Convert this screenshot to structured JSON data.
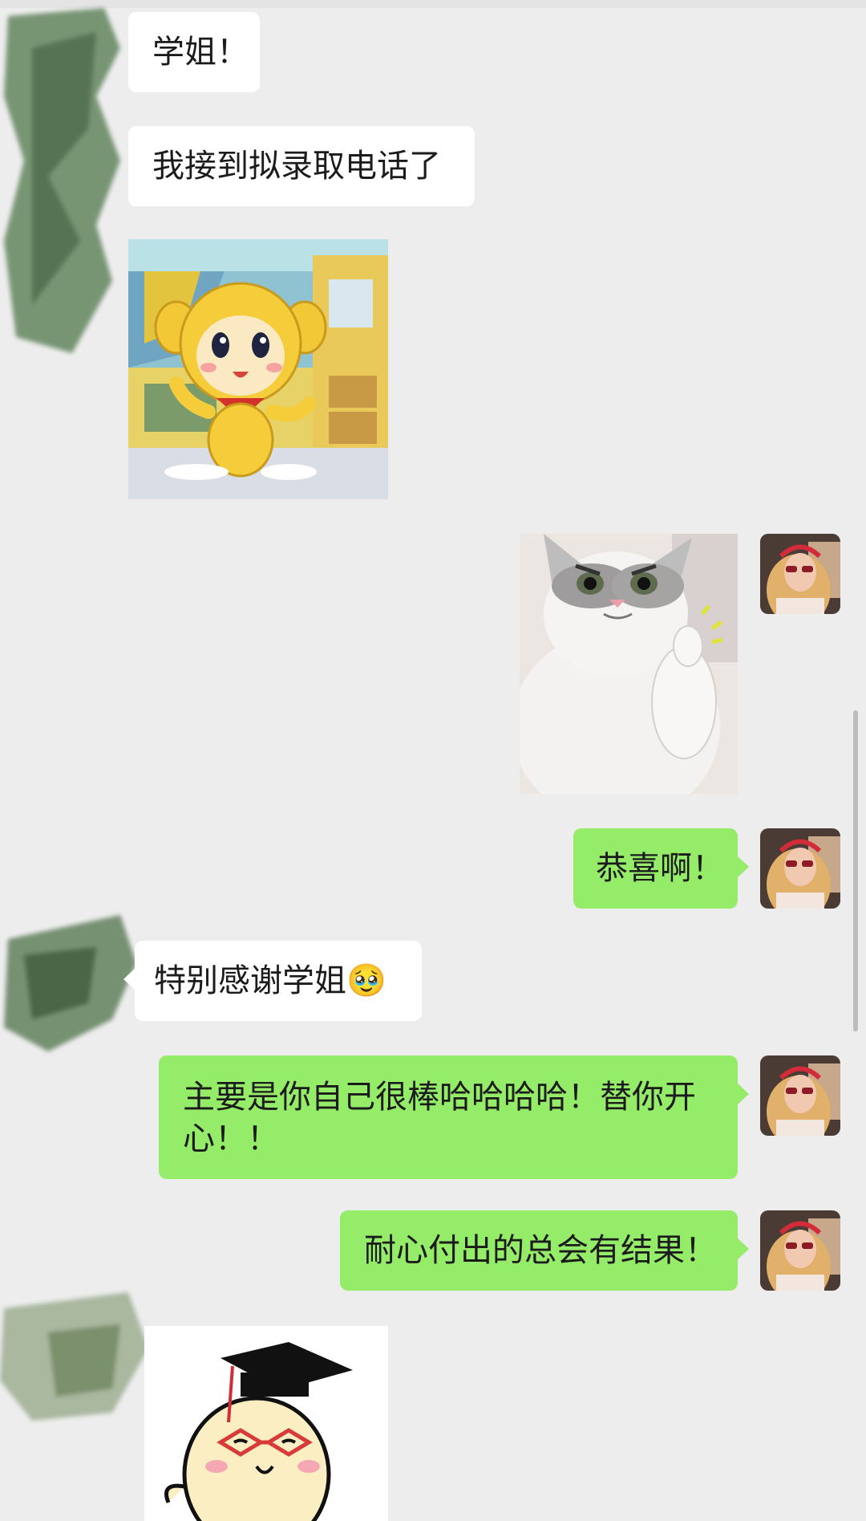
{
  "messages": [
    {
      "id": "m1",
      "side": "in",
      "type": "text",
      "text": "学姐！"
    },
    {
      "id": "m2",
      "side": "in",
      "type": "text",
      "text": "我接到拟录取电话了"
    },
    {
      "id": "m3",
      "side": "in",
      "type": "sticker",
      "icon": "yellow-monkey-sticker"
    },
    {
      "id": "m4",
      "side": "out",
      "type": "sticker",
      "icon": "thumbs-up-cat-sticker"
    },
    {
      "id": "m5",
      "side": "out",
      "type": "text",
      "text": "恭喜啊！"
    },
    {
      "id": "m6",
      "side": "in",
      "type": "text",
      "text": "特别感谢学姐",
      "emoji": "🥹"
    },
    {
      "id": "m7",
      "side": "out",
      "type": "text",
      "text": "主要是你自己很棒哈哈哈哈！替你开心！！"
    },
    {
      "id": "m8",
      "side": "out",
      "type": "text",
      "text": "耐心付出的总会有结果！"
    },
    {
      "id": "m9",
      "side": "in",
      "type": "sticker",
      "icon": "graduation-cap-character-sticker"
    }
  ],
  "colors": {
    "background": "#ededed",
    "incoming_bubble": "#ffffff",
    "outgoing_bubble": "#95ec69",
    "text": "#1b1b1b"
  }
}
